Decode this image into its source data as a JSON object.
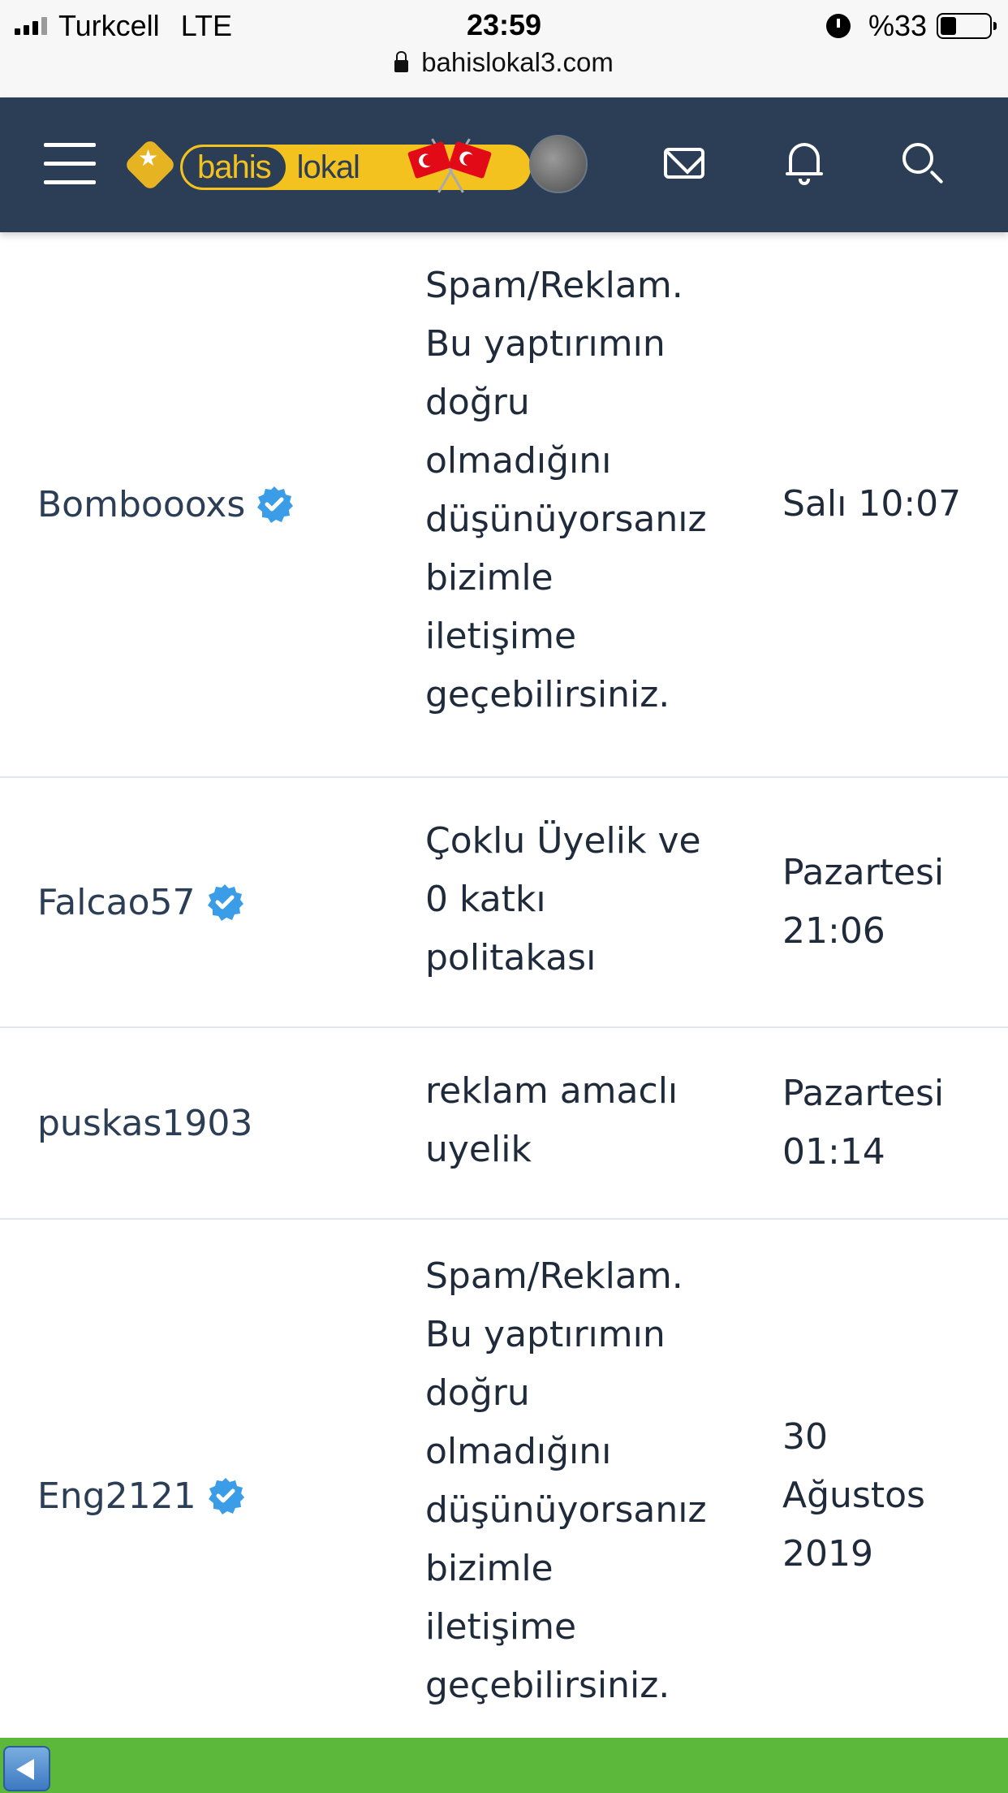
{
  "status_bar": {
    "carrier": "Turkcell",
    "network": "LTE",
    "time": "23:59",
    "battery": "%33",
    "battery_level": 0.33,
    "url": "bahislokal3.com"
  },
  "header": {
    "logo_left": "bahis",
    "logo_right": "lokal",
    "colors": {
      "background": "#2c3e55",
      "logo": "#f3c21f"
    }
  },
  "rows": [
    {
      "username": "Bomboooxs",
      "verified": true,
      "reason": [
        "Spam/Reklam.",
        "Bu yaptırımın",
        "doğru",
        "olmadığını",
        "düşünüyorsanız",
        "bizimle",
        "iletişime",
        "geçebilirsiniz."
      ],
      "date": [
        "Salı 10:07"
      ]
    },
    {
      "username": "Falcao57",
      "verified": true,
      "reason": [
        "Çoklu Üyelik ve",
        "0 katkı",
        "politakası"
      ],
      "date": [
        "Pazartesi",
        "21:06"
      ]
    },
    {
      "username": "puskas1903",
      "verified": false,
      "reason": [
        "reklam amaclı",
        "uyelik"
      ],
      "date": [
        "Pazartesi",
        "01:14"
      ]
    },
    {
      "username": "Eng2121",
      "verified": true,
      "reason": [
        "Spam/Reklam.",
        "Bu yaptırımın",
        "doğru",
        "olmadığını",
        "düşünüyorsanız",
        "bizimle",
        "iletişime",
        "geçebilirsiniz."
      ],
      "date": [
        "30",
        "Ağustos",
        "2019"
      ]
    }
  ],
  "colors": {
    "verified_badge": "#3b9ce8",
    "bottom_bar": "#5cb83a"
  }
}
